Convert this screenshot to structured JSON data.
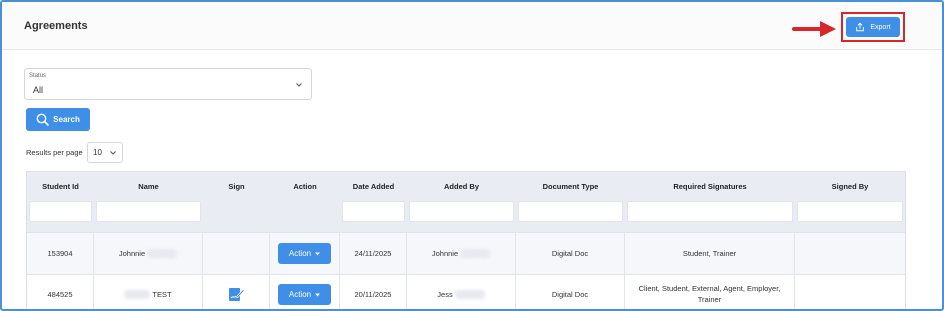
{
  "header": {
    "title": "Agreements",
    "export_label": "Export"
  },
  "filters": {
    "status_label": "Status",
    "status_value": "All",
    "search_label": "Search",
    "results_per_page_label": "Results per page",
    "results_per_page_value": "10"
  },
  "table": {
    "columns": [
      "Student Id",
      "Name",
      "Sign",
      "Action",
      "Date Added",
      "Added By",
      "Document Type",
      "Required Signatures",
      "Signed By"
    ],
    "rows": [
      {
        "student_id": "153904",
        "name": "Johnnie",
        "action": "Action",
        "date_added": "24/11/2025",
        "added_by": "Johnnie",
        "document_type": "Digital Doc",
        "required_signatures": "Student, Trainer",
        "signed_by": ""
      },
      {
        "student_id": "484525",
        "name": "TEST",
        "action": "Action",
        "date_added": "20/11/2025",
        "added_by": "Jess",
        "document_type": "Digital Doc",
        "required_signatures": "Client, Student, External, Agent, Employer, Trainer",
        "signed_by": ""
      }
    ]
  },
  "colors": {
    "primary": "#3f8ee8",
    "highlight": "#d9262a",
    "frame": "#4a90d9"
  },
  "icons": [
    "export-icon",
    "search-icon",
    "chevron-down-icon",
    "caret-down-icon",
    "sign-document-icon",
    "arrow-right-icon"
  ]
}
